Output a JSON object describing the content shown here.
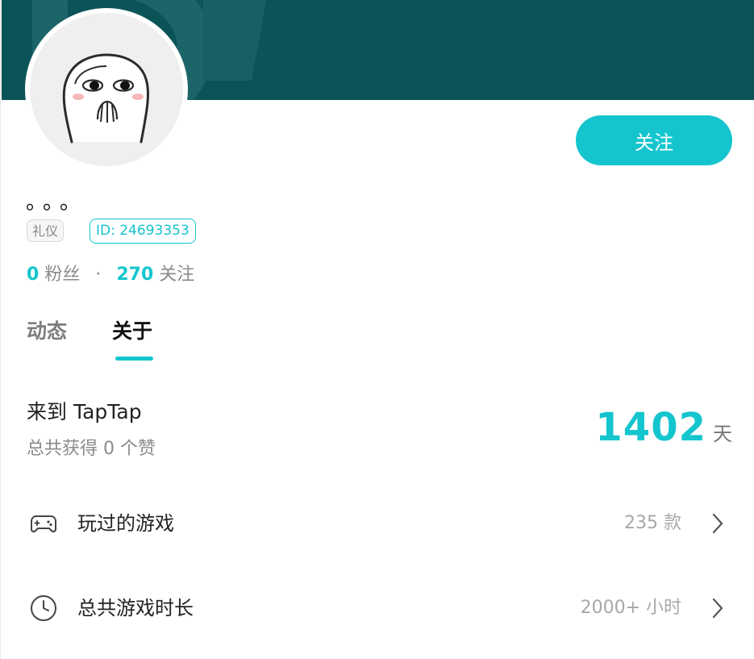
{
  "profile": {
    "username": "。。。",
    "badge": "礼仪",
    "id_label": "ID: 24693353",
    "follow_button": "关注",
    "avatar": "sticker-avatar-icon"
  },
  "stats": {
    "fans_count": "0",
    "fans_label": "粉丝",
    "separator": "·",
    "following_count": "270",
    "following_label": "关注"
  },
  "tabs": [
    {
      "label": "动态",
      "active": false
    },
    {
      "label": "关于",
      "active": true
    }
  ],
  "about": {
    "joined_title": "来到 TapTap",
    "likes_text": "总共获得 0 个赞",
    "days_count": "1402",
    "days_unit": "天"
  },
  "rows": [
    {
      "icon": "gamepad-icon",
      "label": "玩过的游戏",
      "value": "235 款"
    },
    {
      "icon": "clock-icon",
      "label": "总共游戏时长",
      "value": "2000+ 小时"
    }
  ],
  "colors": {
    "accent": "#15c5ce",
    "banner": "#0a5458",
    "muted_text": "#8a8a8a"
  }
}
